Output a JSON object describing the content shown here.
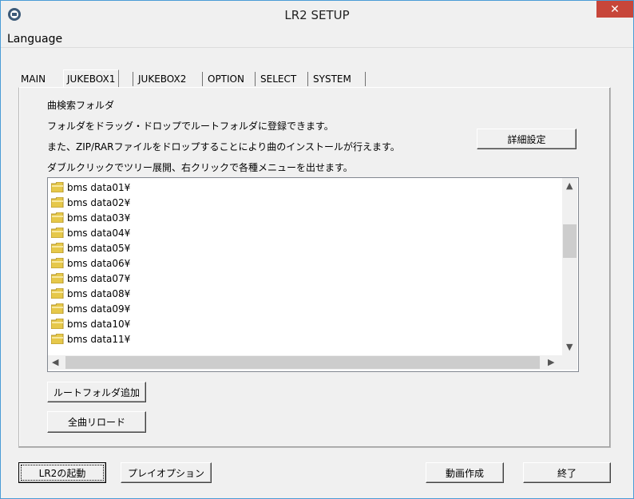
{
  "window": {
    "title": "LR2 SETUP",
    "close_glyph": "✕"
  },
  "menu": {
    "language": "Language"
  },
  "tabs": [
    "MAIN",
    "JUKEBOX1",
    "JUKEBOX2",
    "OPTION",
    "SELECT",
    "SYSTEM"
  ],
  "active_tab": "JUKEBOX1",
  "panel": {
    "heading": "曲検索フォルダ",
    "line1": "フォルダをドラッグ・ドロップでルートフォルダに登録できます。",
    "line2": "また、ZIP/RARファイルをドロップすることにより曲のインストールが行えます。",
    "line3": "ダブルクリックでツリー展開、右クリックで各種メニューを出せます。",
    "detail_button": "詳細設定",
    "folders": [
      "bms data01¥",
      "bms data02¥",
      "bms data03¥",
      "bms data04¥",
      "bms data05¥",
      "bms data06¥",
      "bms data07¥",
      "bms data08¥",
      "bms data09¥",
      "bms data10¥",
      "bms data11¥"
    ],
    "add_root_button": "ルートフォルダ追加",
    "reload_button": "全曲リロード"
  },
  "footer": {
    "launch_button": "LR2の起動",
    "play_option_button": "プレイオプション",
    "movie_button": "動画作成",
    "exit_button": "終了"
  },
  "icons": {
    "app": "lr2-app-icon",
    "folder": "folder-icon"
  }
}
